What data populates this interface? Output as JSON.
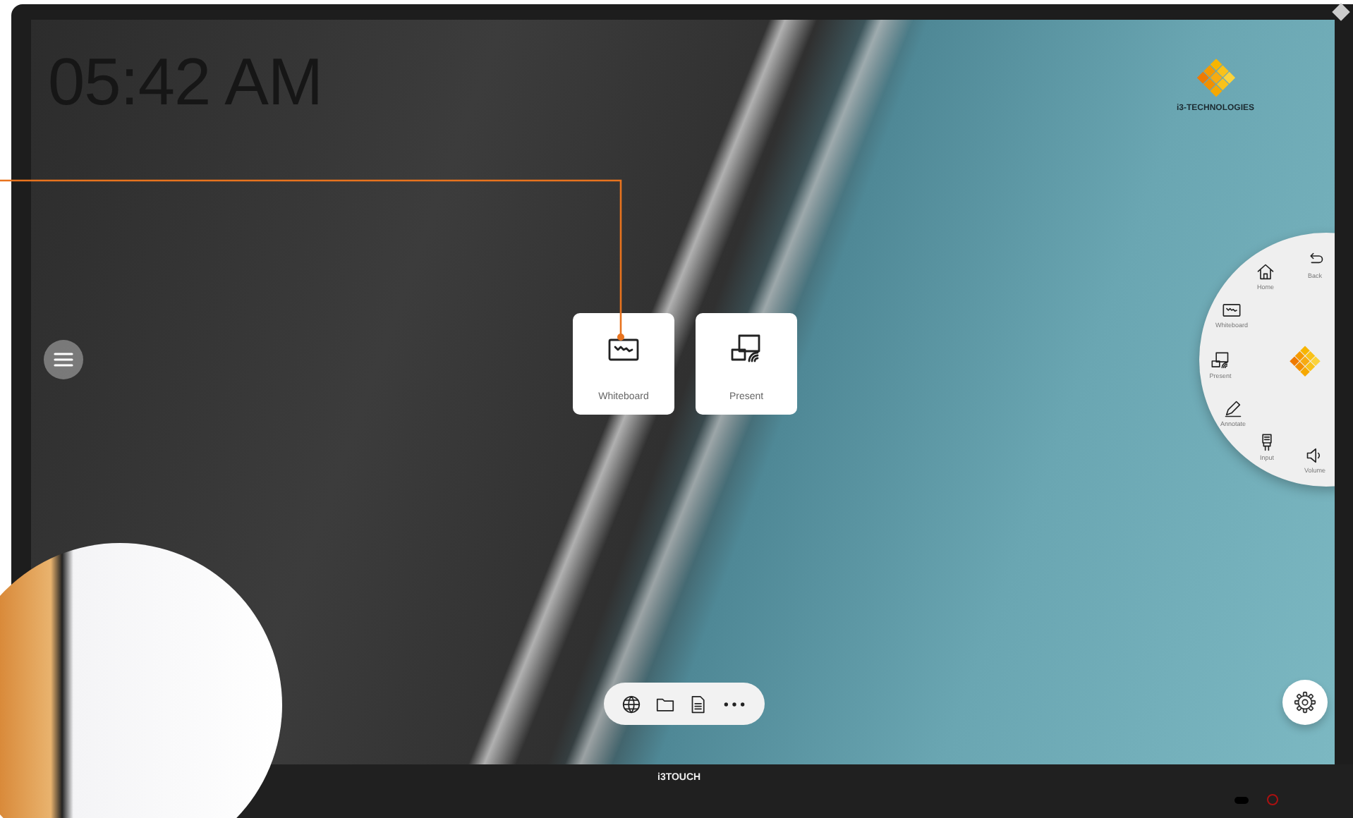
{
  "screen": {
    "clock": "05:42 AM",
    "logo": {
      "text": "i3-TECHNOLOGIES"
    },
    "launch_tiles": [
      {
        "kind": "whiteboard",
        "label": "Whiteboard"
      },
      {
        "kind": "present",
        "label": "Present"
      }
    ],
    "radial_menu": {
      "items": [
        {
          "kind": "back",
          "label": "Back"
        },
        {
          "kind": "home",
          "label": "Home"
        },
        {
          "kind": "whiteboard",
          "label": "Whiteboard"
        },
        {
          "kind": "present",
          "label": "Present"
        },
        {
          "kind": "annotate",
          "label": "Annotate"
        },
        {
          "kind": "input",
          "label": "Input"
        },
        {
          "kind": "volume",
          "label": "Volume"
        }
      ]
    },
    "dock": {
      "items": [
        {
          "kind": "globe"
        },
        {
          "kind": "folder"
        },
        {
          "kind": "document"
        },
        {
          "kind": "more"
        }
      ]
    }
  },
  "bezel": {
    "brand": "i3TOUCH"
  }
}
